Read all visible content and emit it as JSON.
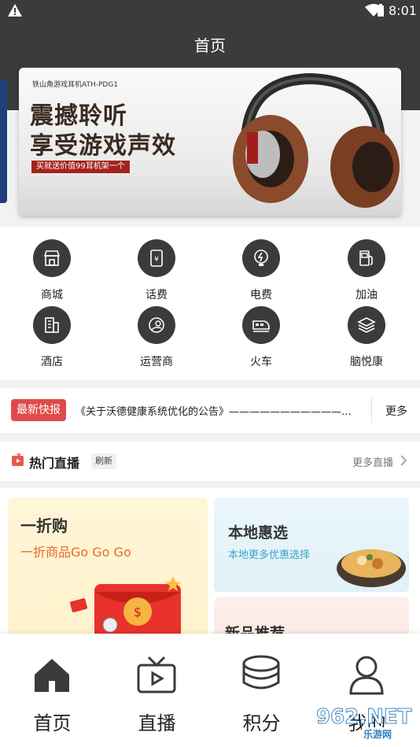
{
  "status_bar": {
    "time": "8:01"
  },
  "header": {
    "title": "首页"
  },
  "banner": {
    "model": "铁山角游戏耳机ATH-PDG1",
    "slogan_line1": "震撼聆听",
    "slogan_line2": "享受游戏声效",
    "promo": "买就送价值99耳机架一个"
  },
  "services": [
    {
      "label": "商城",
      "icon": "store-icon"
    },
    {
      "label": "话费",
      "icon": "phone-bill-icon"
    },
    {
      "label": "电费",
      "icon": "electricity-icon"
    },
    {
      "label": "加油",
      "icon": "fuel-icon"
    },
    {
      "label": "酒店",
      "icon": "hotel-icon"
    },
    {
      "label": "运营商",
      "icon": "carrier-icon"
    },
    {
      "label": "火车",
      "icon": "train-icon"
    },
    {
      "label": "脑悦康",
      "icon": "layers-icon"
    }
  ],
  "news": {
    "tag": "最新快报",
    "text": "《关于沃德健康系统优化的公告》——————————————...",
    "more": "更多"
  },
  "live": {
    "title": "热门直播",
    "refresh": "刷新",
    "more": "更多直播"
  },
  "cards": {
    "left": {
      "title": "一折购",
      "subtitle": "一折商品Go Go Go"
    },
    "right_top": {
      "title": "本地惠选",
      "subtitle": "本地更多优惠选择"
    },
    "right_bottom": {
      "title": "新品推荐"
    }
  },
  "bottom_nav": [
    {
      "label": "首页",
      "icon": "home-icon"
    },
    {
      "label": "直播",
      "icon": "tv-icon"
    },
    {
      "label": "积分",
      "icon": "coins-icon"
    },
    {
      "label": "我的",
      "icon": "person-icon"
    }
  ],
  "watermark": {
    "main": "962.NET",
    "sub": "乐游网"
  },
  "colors": {
    "header": "#3b3b3b",
    "news_tag": "#e04a4a",
    "promo_orange": "#e46a2a",
    "local_blue": "#3aa3c7"
  }
}
